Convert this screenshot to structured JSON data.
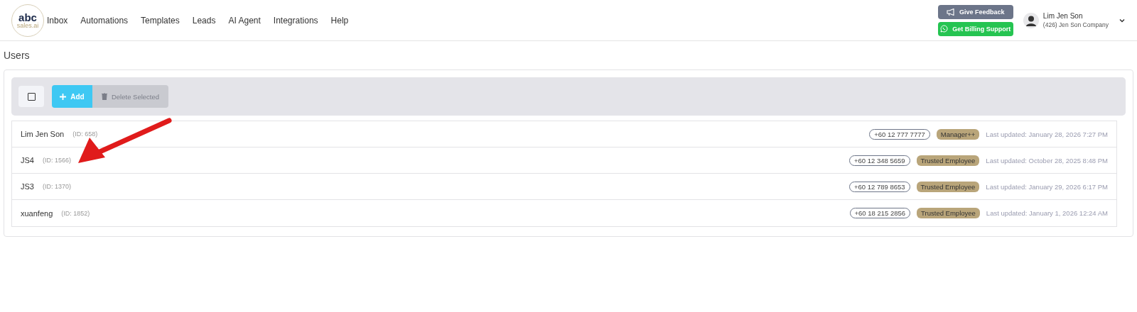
{
  "logo": {
    "top": "abc",
    "bottom": "sales.ai"
  },
  "nav": [
    "Inbox",
    "Automations",
    "Templates",
    "Leads",
    "AI Agent",
    "Integrations",
    "Help"
  ],
  "header_buttons": [
    {
      "label": "Give Feedback",
      "kind": "feedback"
    },
    {
      "label": "Get Billing Support",
      "kind": "whatsapp"
    }
  ],
  "user": {
    "name": "Lim Jen Son",
    "company": "(426) Jen Son Company"
  },
  "page_title": "Users",
  "toolbar": {
    "select_all": {
      "checked": false
    },
    "add": "Add",
    "delete": {
      "label": "Delete Selected",
      "disabled": true
    }
  },
  "users": [
    {
      "name": "Lim Jen Son",
      "id": "(ID: 658)",
      "phone": "+60 12 777 7777",
      "role": "Manager++",
      "updated": "Last updated: January 28, 2026 7:27 PM"
    },
    {
      "name": "JS4",
      "id": "(ID: 1566)",
      "phone": "+60 12 348 5659",
      "role": "Trusted Employee",
      "updated": "Last updated: October 28, 2025 8:48 PM"
    },
    {
      "name": "JS3",
      "id": "(ID: 1370)",
      "phone": "+60 12 789 8653",
      "role": "Trusted Employee",
      "updated": "Last updated: January 29, 2026 6:17 PM"
    },
    {
      "name": "xuanfeng",
      "id": "(ID: 1852)",
      "phone": "+60 18 215 2856",
      "role": "Trusted Employee",
      "updated": "Last updated: January 1, 2026 12:24 AM"
    }
  ]
}
